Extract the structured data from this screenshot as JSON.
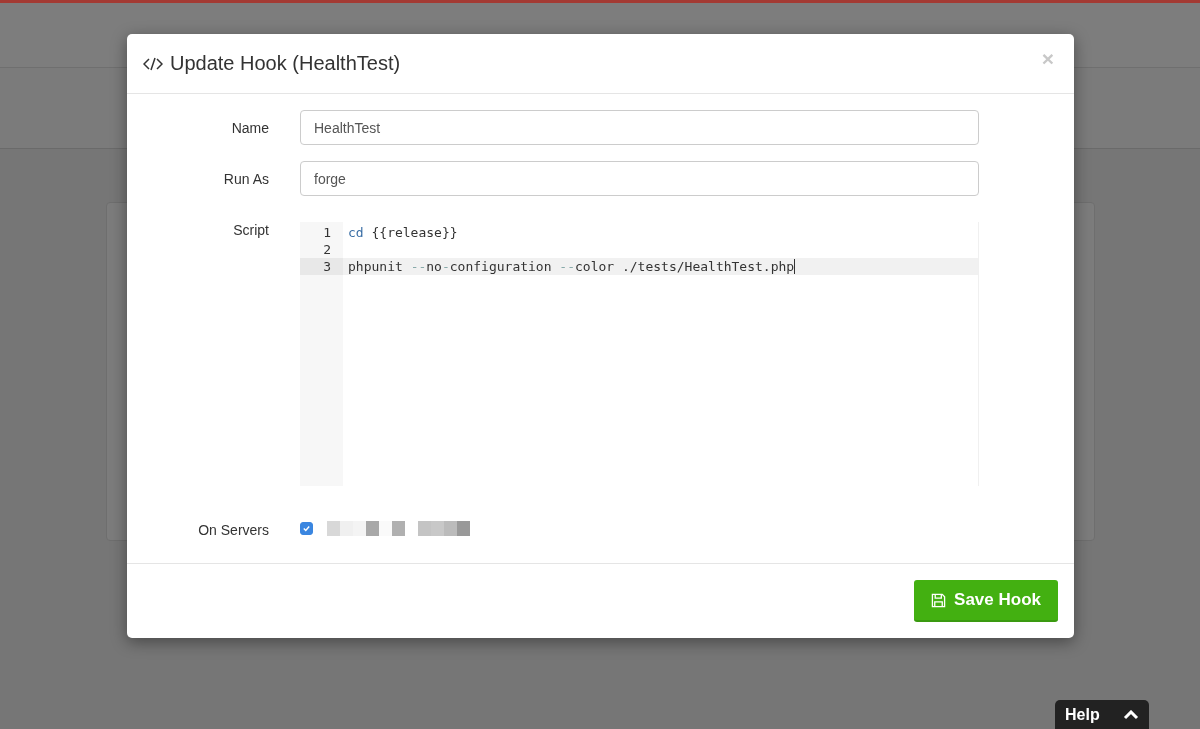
{
  "modal": {
    "title": "Update Hook (HealthTest)",
    "close": "×",
    "fields": [
      {
        "label": "Name",
        "value": "HealthTest"
      },
      {
        "label": "Run As",
        "value": "forge"
      }
    ],
    "script": {
      "label": "Script",
      "lines": [
        {
          "number": "1",
          "active": false,
          "tokens": [
            {
              "text": "cd",
              "kind": "keyword"
            },
            {
              "text": " {{release}}",
              "kind": "plain"
            }
          ]
        },
        {
          "number": "2",
          "active": false
        },
        {
          "number": "3",
          "active": true,
          "tokens": [
            {
              "text": "phpunit ",
              "kind": "plain"
            },
            {
              "text": "--",
              "kind": "operator"
            },
            {
              "text": "no",
              "kind": "plain"
            },
            {
              "text": "-",
              "kind": "operator"
            },
            {
              "text": "configuration ",
              "kind": "plain"
            },
            {
              "text": "--",
              "kind": "operator"
            },
            {
              "text": "color ./tests/HealthTest.php",
              "kind": "plain"
            }
          ]
        }
      ]
    },
    "servers": {
      "label": "On Servers",
      "checked": true
    },
    "save_button": "Save Hook"
  },
  "help_tab": {
    "label": "Help"
  }
}
